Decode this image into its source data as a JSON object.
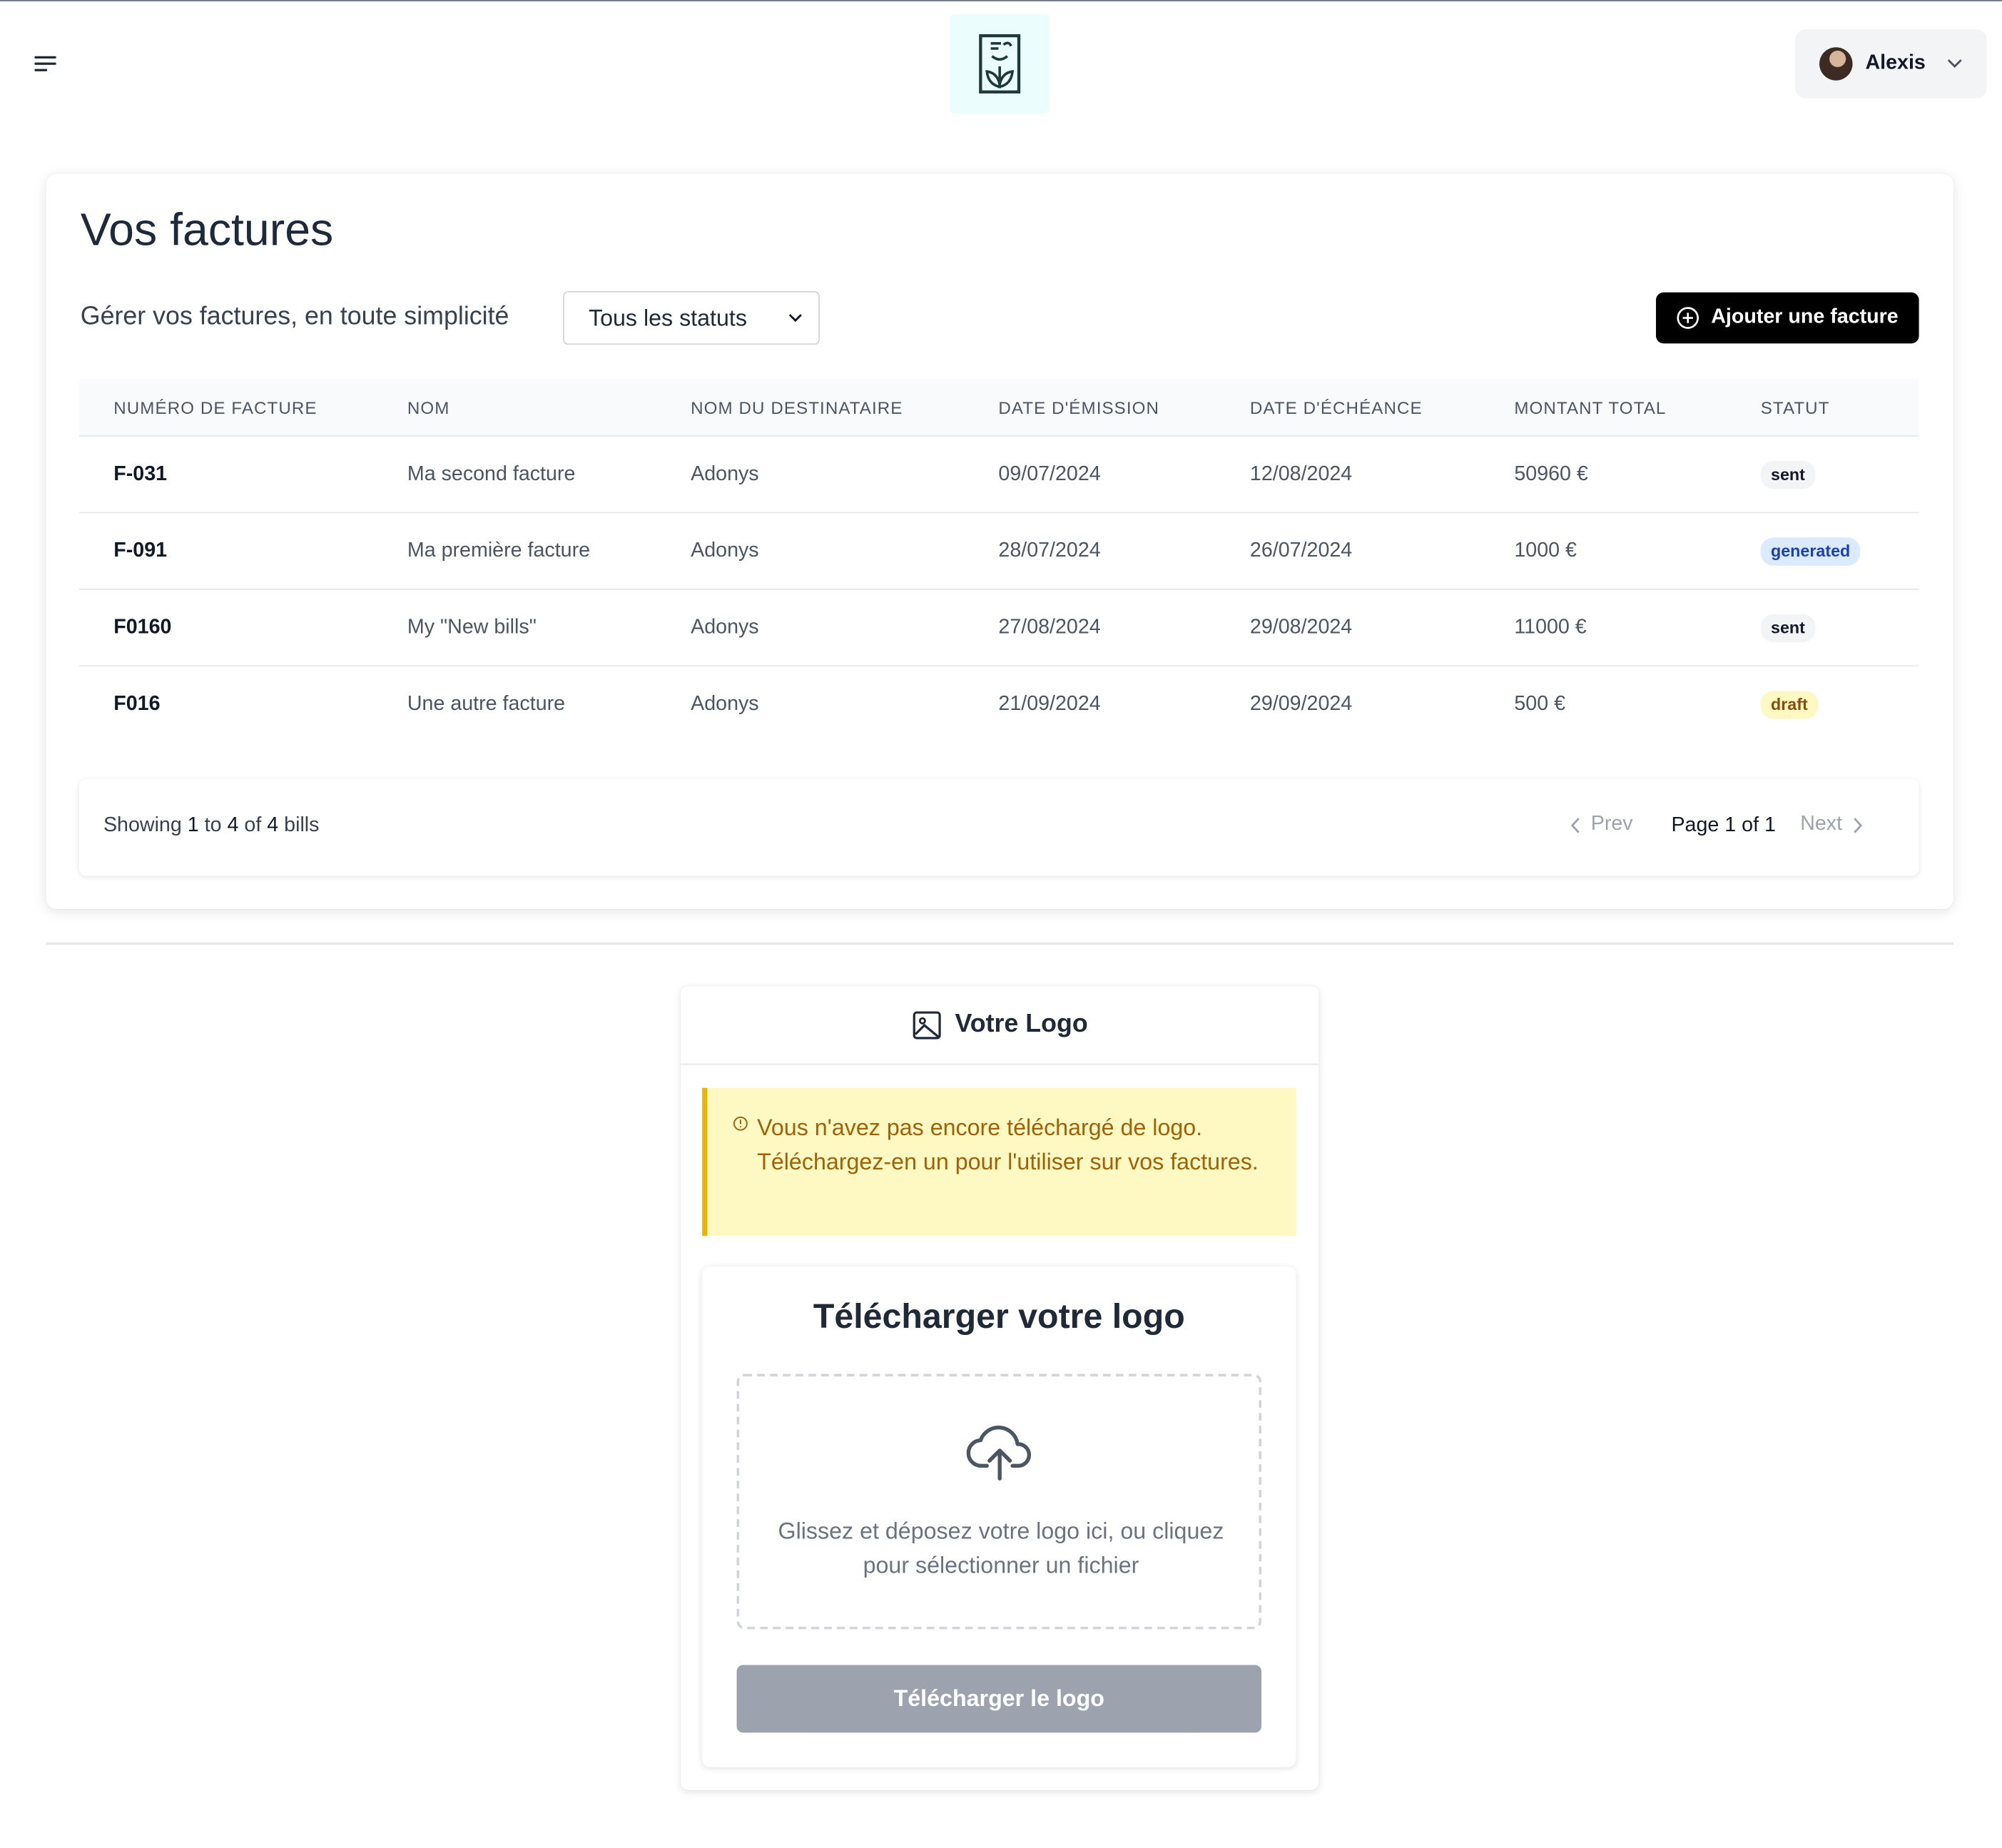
{
  "header": {
    "menu_icon": "menu-icon",
    "logo_icon": "invoice-logo-icon",
    "user": {
      "name": "Alexis",
      "avatar": "avatar-photo",
      "chevron_icon": "chevron-down-icon"
    }
  },
  "invoices": {
    "title": "Vos factures",
    "subtitle": "Gérer vos factures, en toute simplicité",
    "status_filter": {
      "selected": "Tous les statuts",
      "icon": "chevron-down-icon"
    },
    "add_button": {
      "label": "Ajouter une facture",
      "icon": "plus-circle-icon"
    },
    "columns": [
      "Numéro de facture",
      "Nom",
      "Nom du destinataire",
      "Date d'émission",
      "Date d'échéance",
      "Montant total",
      "Statut"
    ],
    "rows": [
      {
        "number": "F-031",
        "name": "Ma second facture",
        "recipient": "Adonys",
        "issue_date": "09/07/2024",
        "due_date": "12/08/2024",
        "total": "50960 €",
        "status": "sent"
      },
      {
        "number": "F-091",
        "name": "Ma première facture",
        "recipient": "Adonys",
        "issue_date": "28/07/2024",
        "due_date": "26/07/2024",
        "total": "1000 €",
        "status": "generated"
      },
      {
        "number": "F0160",
        "name": "My \"New bills\"",
        "recipient": "Adonys",
        "issue_date": "27/08/2024",
        "due_date": "29/08/2024",
        "total": "11000 €",
        "status": "sent"
      },
      {
        "number": "F016",
        "name": "Une autre facture",
        "recipient": "Adonys",
        "issue_date": "21/09/2024",
        "due_date": "29/09/2024",
        "total": "500 €",
        "status": "draft"
      }
    ],
    "status_colors": {
      "sent": {
        "bg": "#f3f4f6",
        "fg": "#111827"
      },
      "generated": {
        "bg": "#dbeafe",
        "fg": "#1e40af"
      },
      "draft": {
        "bg": "#fef9c3",
        "fg": "#854d0e"
      }
    },
    "pagination": {
      "showing_prefix": "Showing",
      "from": "1",
      "to_word": "to",
      "to": "4",
      "of_word": "of",
      "total": "4",
      "suffix": "bills",
      "prev": "Prev",
      "page_info": "Page 1 of 1",
      "next": "Next"
    }
  },
  "logo_section": {
    "title": "Votre Logo",
    "title_icon": "image-icon",
    "warning": "Vous n'avez pas encore téléchargé de logo. Téléchargez-en un pour l'utiliser sur vos factures.",
    "warning_icon": "info-circle-icon",
    "upload_title": "Télécharger votre logo",
    "upload_icon": "cloud-upload-icon",
    "drop_text": "Glissez et déposez votre logo ici, ou cliquez pour sélectionner un fichier",
    "upload_button": "Télécharger le logo"
  },
  "colors": {
    "primary_button": "#000000",
    "disabled_button": "#9ca3af",
    "warning_bg": "#fef9c3",
    "warning_border": "#eab308",
    "warning_text": "#a16207"
  }
}
